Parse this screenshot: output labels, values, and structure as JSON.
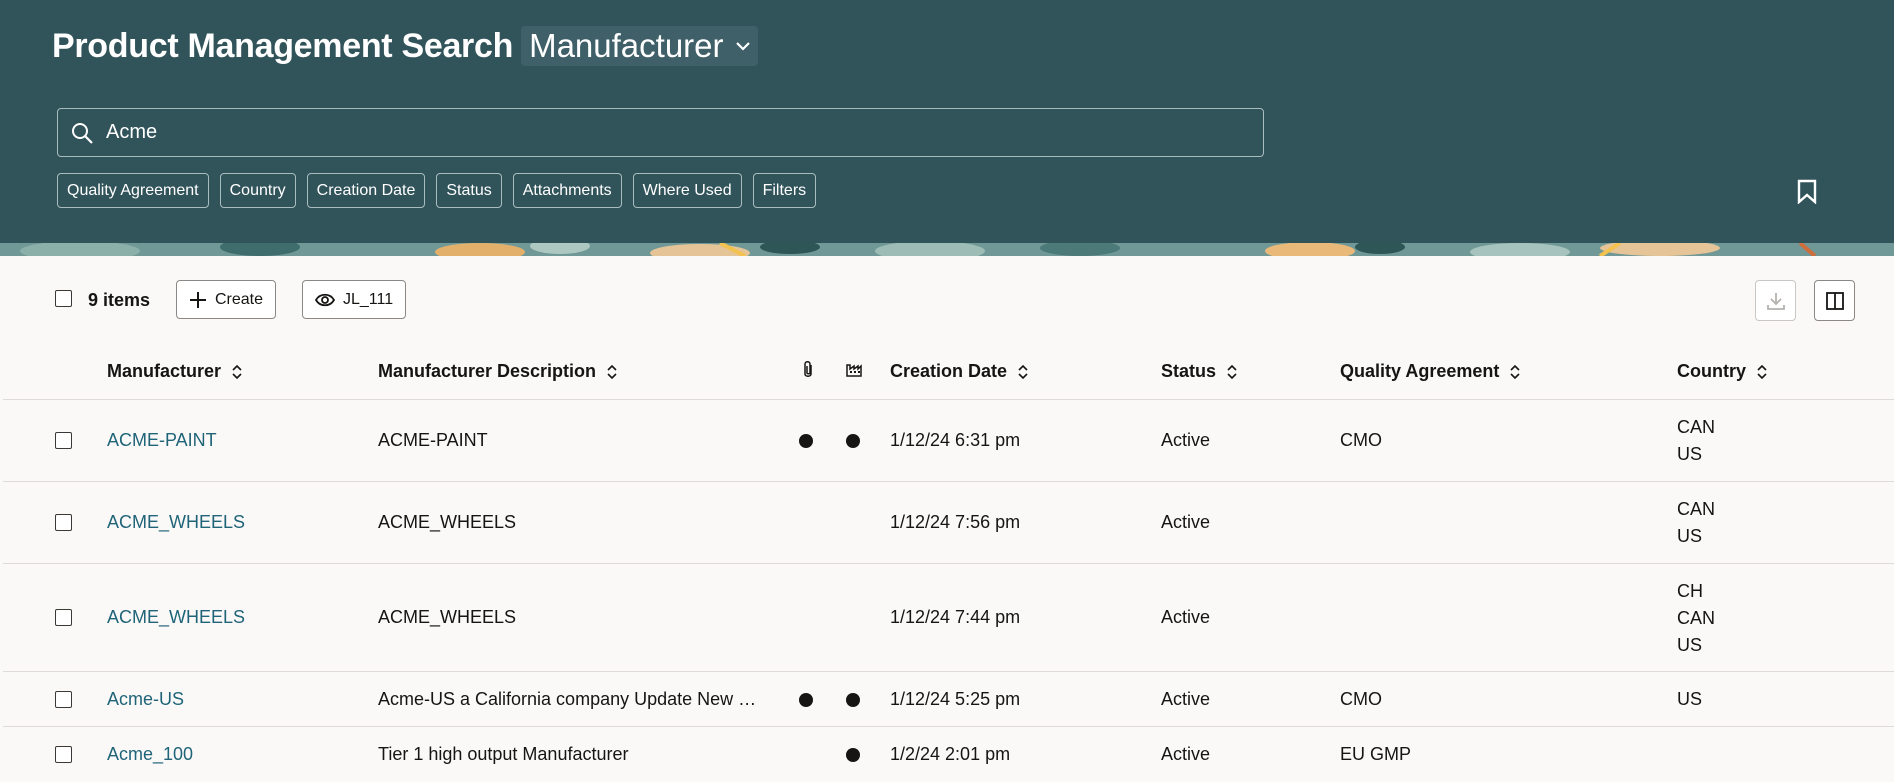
{
  "header": {
    "title": "Product Management Search",
    "object_type": "Manufacturer",
    "search_value": "Acme",
    "filter_chips": [
      "Quality Agreement",
      "Country",
      "Creation Date",
      "Status",
      "Attachments",
      "Where Used",
      "Filters"
    ]
  },
  "toolbar": {
    "item_count": "9 items",
    "create_label": "Create",
    "view_label": "JL_111"
  },
  "table": {
    "columns": {
      "manufacturer": "Manufacturer",
      "description": "Manufacturer Description",
      "attachments_icon": "paperclip-icon",
      "where_used_icon": "factory-icon",
      "creation_date": "Creation Date",
      "status": "Status",
      "quality_agreement": "Quality Agreement",
      "country": "Country"
    },
    "rows": [
      {
        "manufacturer": "ACME-PAINT",
        "description": "ACME-PAINT",
        "attachments": true,
        "where_used": true,
        "creation_date": "1/12/24 6:31 pm",
        "status": "Active",
        "quality_agreement": "CMO",
        "country": [
          "CAN",
          "US"
        ]
      },
      {
        "manufacturer": "ACME_WHEELS",
        "description": "ACME_WHEELS",
        "attachments": false,
        "where_used": false,
        "creation_date": "1/12/24 7:56 pm",
        "status": "Active",
        "quality_agreement": "",
        "country": [
          "CAN",
          "US"
        ]
      },
      {
        "manufacturer": "ACME_WHEELS",
        "description": "ACME_WHEELS",
        "attachments": false,
        "where_used": false,
        "creation_date": "1/12/24 7:44 pm",
        "status": "Active",
        "quality_agreement": "",
        "country": [
          "CH",
          "CAN",
          "US"
        ]
      },
      {
        "manufacturer": "Acme-US",
        "description": "Acme-US a California company Update New …",
        "attachments": true,
        "where_used": true,
        "creation_date": "1/12/24 5:25 pm",
        "status": "Active",
        "quality_agreement": "CMO",
        "country": [
          "US"
        ]
      },
      {
        "manufacturer": "Acme_100",
        "description": "Tier 1 high output Manufacturer",
        "attachments": false,
        "where_used": true,
        "creation_date": "1/2/24 2:01 pm",
        "status": "Active",
        "quality_agreement": "EU GMP",
        "country": []
      }
    ]
  },
  "colors": {
    "header_bg": "#31535a",
    "link": "#1f6478",
    "page_bg": "#fbf9f8"
  }
}
